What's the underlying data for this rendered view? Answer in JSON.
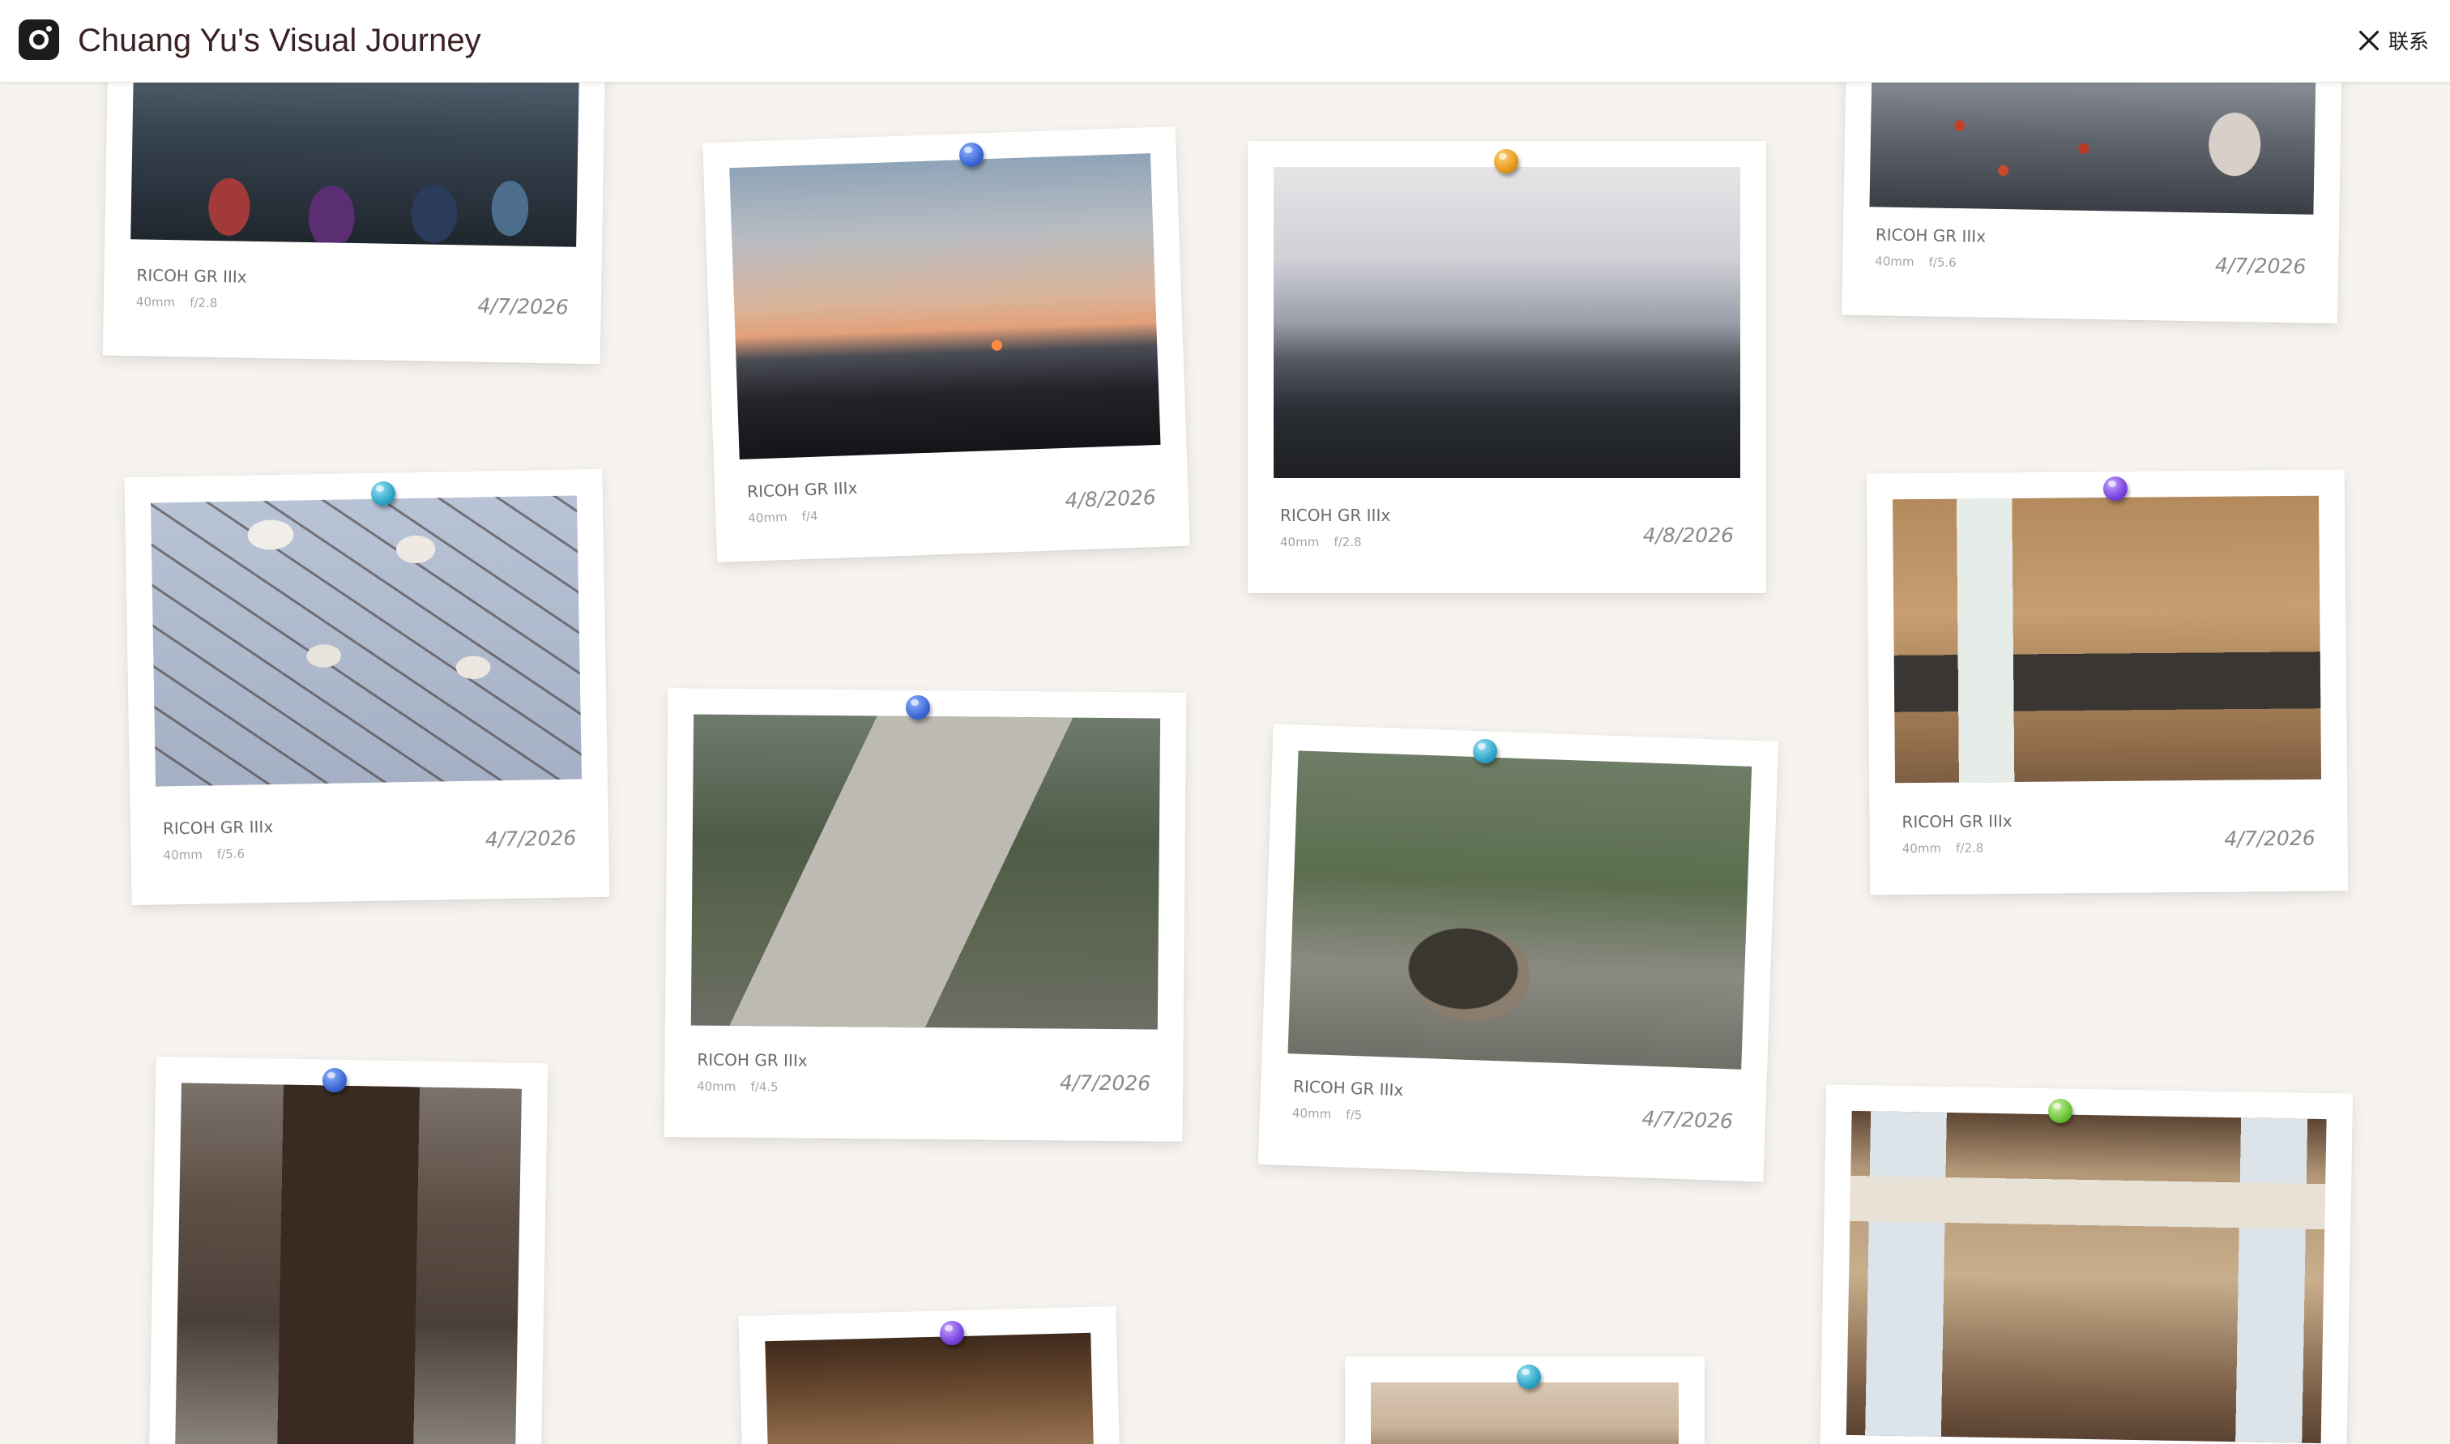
{
  "header": {
    "title": "Chuang Yu's Visual Journey",
    "contact_label": "联系"
  },
  "photos": [
    {
      "camera": "RICOH GR IIIx",
      "focal": "40mm",
      "aperture": "f/2.8",
      "date": "4/7/2026"
    },
    {
      "camera": "RICOH GR IIIx",
      "focal": "40mm",
      "aperture": "f/4",
      "date": "4/8/2026"
    },
    {
      "camera": "RICOH GR IIIx",
      "focal": "40mm",
      "aperture": "f/2.8",
      "date": "4/8/2026"
    },
    {
      "camera": "RICOH GR IIIx",
      "focal": "40mm",
      "aperture": "f/5.6",
      "date": "4/7/2026"
    },
    {
      "camera": "RICOH GR IIIx",
      "focal": "40mm",
      "aperture": "f/5.6",
      "date": "4/7/2026"
    },
    {
      "camera": "RICOH GR IIIx",
      "focal": "40mm",
      "aperture": "f/4.5",
      "date": "4/7/2026"
    },
    {
      "camera": "RICOH GR IIIx",
      "focal": "40mm",
      "aperture": "f/5",
      "date": "4/7/2026"
    },
    {
      "camera": "RICOH GR IIIx",
      "focal": "40mm",
      "aperture": "f/2.8",
      "date": "4/7/2026"
    }
  ],
  "colors": {
    "background": "#f7f4f0",
    "title": "#3a2224",
    "pin_blue": "#3c68d6",
    "pin_orange": "#e69a1b",
    "pin_teal": "#2ea6c9",
    "pin_purple": "#7a45e0",
    "pin_green": "#6cc23a"
  },
  "icons": {
    "logo": "camera-icon",
    "contact": "x-icon"
  }
}
